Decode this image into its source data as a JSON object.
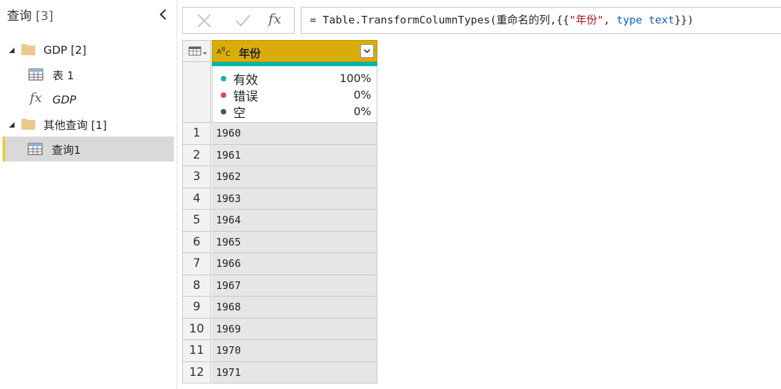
{
  "query_pane": {
    "title": "查询",
    "count": "[3]",
    "groups": [
      {
        "name": "GDP",
        "count": "[2]",
        "items": [
          {
            "label": "表 1",
            "icon": "table-icon"
          },
          {
            "label": "GDP",
            "icon": "function-icon"
          }
        ]
      },
      {
        "name": "其他查询",
        "count": "[1]",
        "items": [
          {
            "label": "查询1",
            "icon": "table-icon",
            "selected": true
          }
        ]
      }
    ]
  },
  "formula_bar": {
    "cancel_icon": "close-icon",
    "commit_icon": "check-icon",
    "fx_label": "fx",
    "formula_prefix": "= Table.TransformColumnTypes(重命名的列,{{",
    "formula_string": "\"年份\"",
    "formula_sep": ", ",
    "formula_kw1": "type",
    "formula_space": " ",
    "formula_kw2": "text",
    "formula_suffix": "}})"
  },
  "grid": {
    "column": {
      "name": "年份",
      "type_icon": "text-type-icon",
      "type_label": "ABC",
      "header_color": "#d8ad0b"
    },
    "quality": [
      {
        "label": "有效",
        "value": "100%",
        "color": "#01b8aa"
      },
      {
        "label": "错误",
        "value": "0%",
        "color": "#e8474f"
      },
      {
        "label": "空",
        "value": "0%",
        "color": "#505050"
      }
    ],
    "rows": [
      {
        "n": "1",
        "v": "1960"
      },
      {
        "n": "2",
        "v": "1961"
      },
      {
        "n": "3",
        "v": "1962"
      },
      {
        "n": "4",
        "v": "1963"
      },
      {
        "n": "5",
        "v": "1964"
      },
      {
        "n": "6",
        "v": "1965"
      },
      {
        "n": "7",
        "v": "1966"
      },
      {
        "n": "8",
        "v": "1967"
      },
      {
        "n": "9",
        "v": "1968"
      },
      {
        "n": "10",
        "v": "1969"
      },
      {
        "n": "11",
        "v": "1970"
      },
      {
        "n": "12",
        "v": "1971"
      }
    ]
  }
}
